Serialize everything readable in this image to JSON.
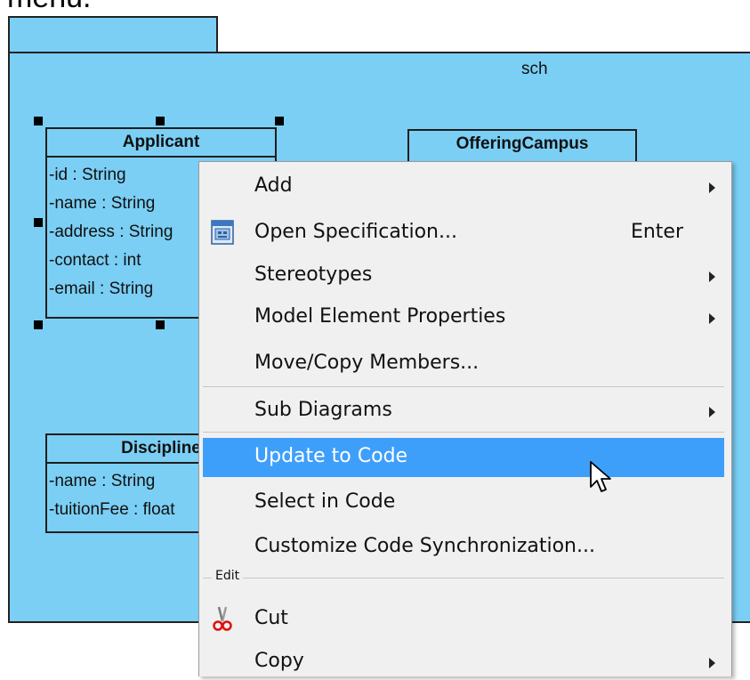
{
  "caption": {
    "text": "menu."
  },
  "package": {
    "name": "sch"
  },
  "classes": {
    "applicant": {
      "name": "Applicant",
      "attributes": [
        "-id : String",
        "-name : String",
        "-address : String",
        "-contact : int",
        "-email : String"
      ]
    },
    "offering_campus": {
      "name": "OfferingCampus"
    },
    "discipline": {
      "name": "Discipline",
      "attributes": [
        "-name : String",
        "-tuitionFee : float"
      ]
    }
  },
  "context_menu": {
    "items": [
      {
        "label": "Add",
        "submenu": true
      },
      {
        "label": "Open Specification...",
        "shortcut": "Enter",
        "icon": "specification-icon"
      },
      {
        "label": "Stereotypes",
        "submenu": true
      },
      {
        "label": "Model Element Properties",
        "submenu": true
      },
      {
        "label": "Move/Copy Members..."
      },
      {
        "label": "Sub Diagrams",
        "submenu": true
      },
      {
        "label": "Update to Code",
        "highlighted": true
      },
      {
        "label": "Select in Code"
      },
      {
        "label": "Customize Code Synchronization..."
      },
      {
        "label": "Cut",
        "icon": "scissors-icon"
      },
      {
        "label": "Copy",
        "submenu": true
      }
    ],
    "group_label": "Edit"
  },
  "colors": {
    "package_fill": "#7bcff5",
    "menu_background": "#f0f0f0",
    "highlight": "#3e9ffb"
  }
}
